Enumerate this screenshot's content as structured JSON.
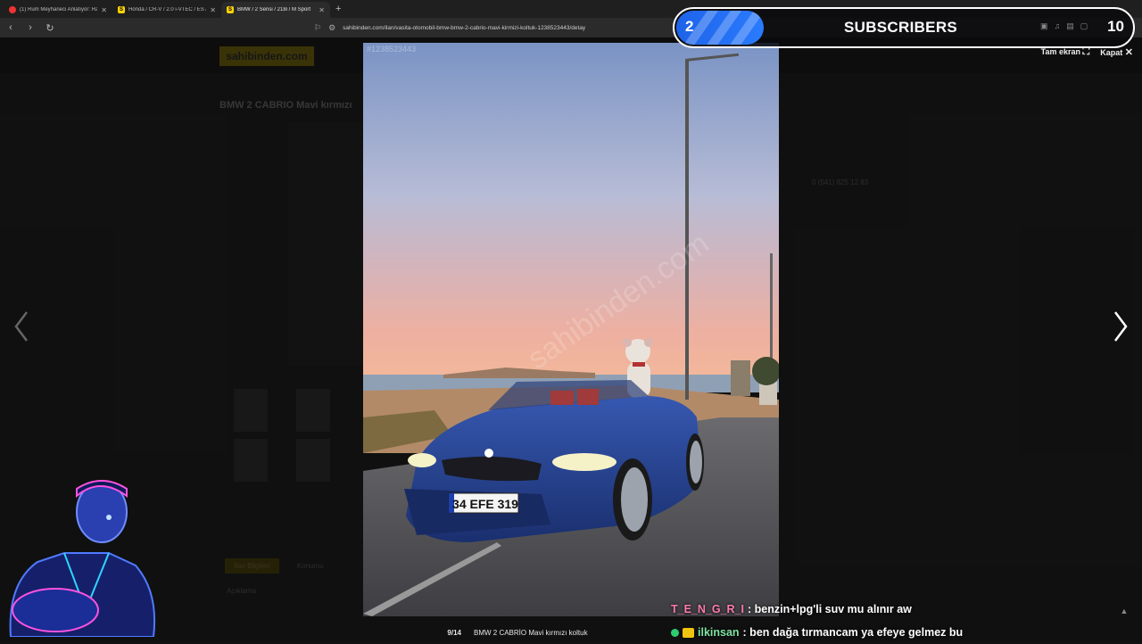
{
  "browser": {
    "tabs": [
      {
        "title": "(1) Rum Meyhaneci Anlatıyor: Rakı R",
        "icon": "youtube-icon",
        "active": false
      },
      {
        "title": "Honda / CR-V / 2.0 i-VTEC / ES / Exe",
        "icon": "sahibinden-icon",
        "active": false
      },
      {
        "title": "BMW / 2 Serisi / 218i / M Sport",
        "icon": "sahibinden-icon",
        "active": true
      }
    ],
    "tab_favicon_letter": "S",
    "url": "sahibinden.com/ilan/vasita-otomobil-bmw-bmw-2-cabrio-mavi-kirmizi-koltuk-1238523443/detay"
  },
  "background_page": {
    "logo": "sahibinden.com",
    "title": "BMW 2 CABRIO Mavi kırmızı",
    "phone": "0 (541) 825 12 83",
    "tabs": [
      "İlan Bilgileri",
      "Konumu"
    ],
    "section": "Açıklama"
  },
  "lightbox": {
    "ad_id": "#1238523443",
    "fullscreen_label": "Tam ekran",
    "close_label": "Kapat",
    "counter": "9/14",
    "caption": "BMW 2 CABRİO Mavi kırmızı koltuk",
    "plate": "34 EFE 319",
    "watermark": "sahibinden.com"
  },
  "stream_overlay": {
    "subscribers_count": "2",
    "subscribers_label": "SUBSCRIBERS",
    "subscribers_goal": "10",
    "progress_fraction": 0.2
  },
  "chat": [
    {
      "user": "T_E_N_G_R_I",
      "message": ": benzin+lpg'li suv mu alınır aw",
      "color": "#ff7aa8"
    },
    {
      "user": "ilkinsan",
      "message": ": ben dağa tırmancam ya efeye gelmez bu",
      "color": "#7fe3a2"
    }
  ],
  "colors": {
    "accent": "#2a7bff",
    "car_blue": "#22408f",
    "brand_yellow": "#ffd400"
  }
}
